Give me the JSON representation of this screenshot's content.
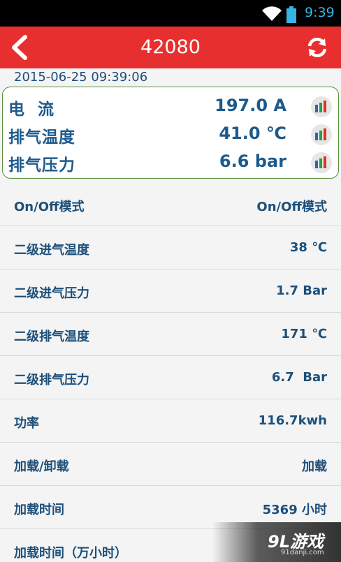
{
  "status_bar": {
    "time": "9:39"
  },
  "header": {
    "title": "42080"
  },
  "timestamp": "2015-06-25 09:39:06",
  "summary": [
    {
      "label": "电  流",
      "value": "197.0 A"
    },
    {
      "label": "排气温度",
      "value": "41.0 ℃"
    },
    {
      "label": "排气压力",
      "value": "6.6 bar"
    }
  ],
  "list": [
    {
      "key": "On/Off模式",
      "value": "On/Off模式"
    },
    {
      "key": "二级进气温度",
      "value": "38 ℃"
    },
    {
      "key": "二级进气压力",
      "value": "1.7 Bar"
    },
    {
      "key": "二级排气温度",
      "value": "171 ℃"
    },
    {
      "key": "二级排气压力",
      "value": "6.7  Bar"
    },
    {
      "key": "功率",
      "value": "116.7kwh"
    },
    {
      "key": "加载/卸载",
      "value": "加载"
    },
    {
      "key": "加载时间",
      "value": "5369 小时"
    },
    {
      "key": "加载时间（万小时）",
      "value": ""
    }
  ],
  "watermark": {
    "logo": "9L游戏",
    "site": "91danji.com"
  },
  "colors": {
    "header": "#e82f2f",
    "text": "#1c5a8c",
    "card_border": "#5b8f3a"
  }
}
